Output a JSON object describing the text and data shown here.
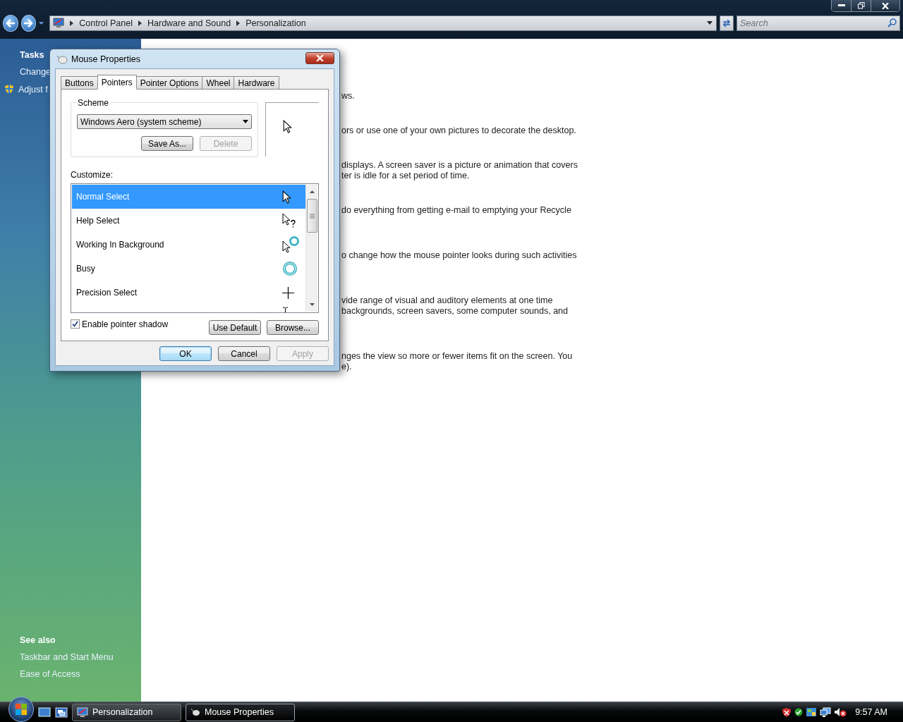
{
  "explorer": {
    "breadcrumb": [
      "Control Panel",
      "Hardware and Sound",
      "Personalization"
    ],
    "search": {
      "placeholder": "Search"
    },
    "sidebar": {
      "tasks_title": "Tasks",
      "tasks": [
        {
          "label": "Change",
          "kind": "plain"
        },
        {
          "label": "Adjust f",
          "kind": "shield"
        }
      ],
      "see_also_title": "See also",
      "see_also": [
        "Taskbar and Start Menu",
        "Ease of Access"
      ]
    },
    "sections": [
      {
        "lines": [
          "ws."
        ]
      },
      {
        "lines": [
          "ors or use one of your own pictures to decorate the desktop."
        ]
      },
      {
        "lines": [
          "displays. A screen saver is a picture or animation that covers",
          "ter is idle for a set period of time."
        ]
      },
      {
        "lines": [
          "do everything from getting e-mail to emptying your Recycle"
        ]
      },
      {
        "lines": [
          "o change how the mouse pointer looks during such activities"
        ]
      },
      {
        "lines": [
          "vide range of visual and auditory elements at one time",
          "backgrounds, screen savers, some computer sounds, and"
        ]
      },
      {
        "lines": [
          "nges the view so more or fewer items fit on the screen. You",
          "e)."
        ]
      }
    ]
  },
  "dialog": {
    "title": "Mouse Properties",
    "tabs": [
      {
        "label": "Buttons",
        "selected": false
      },
      {
        "label": "Pointers",
        "selected": true
      },
      {
        "label": "Pointer Options",
        "selected": false
      },
      {
        "label": "Wheel",
        "selected": false
      },
      {
        "label": "Hardware",
        "selected": false
      }
    ],
    "scheme": {
      "label": "Scheme",
      "value": "Windows Aero (system scheme)",
      "buttons": [
        {
          "label": "Save As...",
          "disabled": false
        },
        {
          "label": "Delete",
          "disabled": true
        }
      ]
    },
    "customize_label": "Customize:",
    "cursors": [
      {
        "label": "Normal Select",
        "kind": "arrow",
        "selected": true
      },
      {
        "label": "Help Select",
        "kind": "help",
        "selected": false
      },
      {
        "label": "Working In Background",
        "kind": "working",
        "selected": false
      },
      {
        "label": "Busy",
        "kind": "busy",
        "selected": false
      },
      {
        "label": "Precision Select",
        "kind": "cross",
        "selected": false
      },
      {
        "kind": "beam",
        "selected": false
      }
    ],
    "shadow": {
      "label": "Enable pointer shadow",
      "checked": true
    },
    "list_buttons": [
      {
        "label": "Use Default",
        "disabled": false
      },
      {
        "label": "Browse...",
        "disabled": false
      }
    ],
    "footer_buttons": [
      {
        "label": "OK",
        "disabled": false,
        "default": true
      },
      {
        "label": "Cancel",
        "disabled": false,
        "default": false
      },
      {
        "label": "Apply",
        "disabled": true,
        "default": false
      }
    ]
  },
  "taskbar": {
    "tasks": [
      {
        "label": "Personalization",
        "kind": "display",
        "selected": false
      },
      {
        "label": "Mouse Properties",
        "kind": "mouse",
        "selected": true
      }
    ],
    "clock": "9:57 AM"
  }
}
